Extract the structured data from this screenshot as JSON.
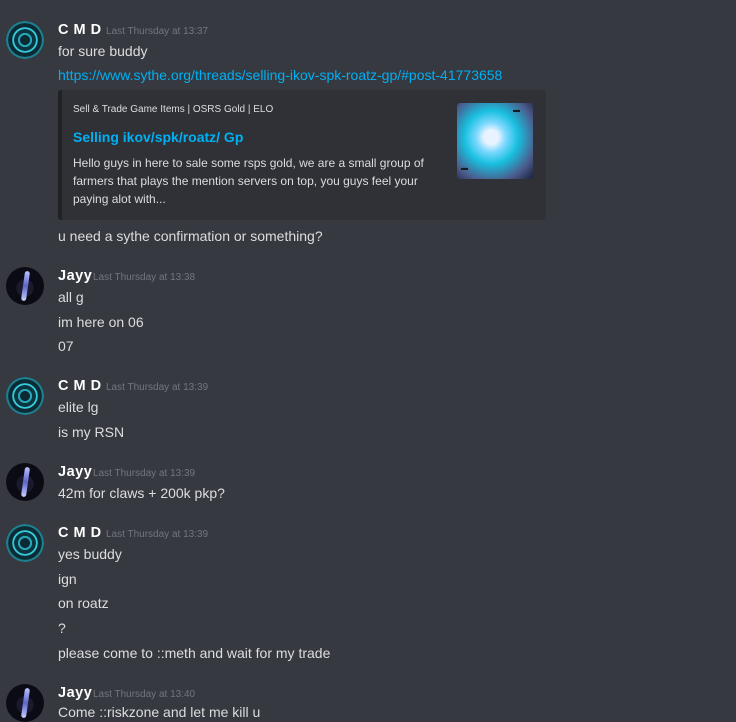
{
  "groups": [
    {
      "user": "C M D",
      "timestamp": "Last Thursday at 13:37",
      "messages": [
        "for sure buddy"
      ],
      "link": "https://www.sythe.org/threads/selling-ikov-spk-roatz-gp/#post-41773658",
      "embed": {
        "provider": "Sell & Trade Game Items | OSRS Gold | ELO",
        "title": "Selling ikov/spk/roatz/ Gp",
        "description": "Hello guys in here to sale some rsps gold, we are a small group of farmers that plays the mention servers on top, you guys feel your paying alot with..."
      },
      "after_embed": "u need a sythe confirmation or something?"
    },
    {
      "user": "Jayy",
      "timestamp": "Last Thursday at 13:38",
      "messages": [
        "all g",
        "im here on 06",
        "07"
      ]
    },
    {
      "user": "C M D",
      "timestamp": "Last Thursday at 13:39",
      "messages": [
        "elite lg",
        "is my RSN"
      ]
    },
    {
      "user": "Jayy",
      "timestamp": "Last Thursday at 13:39",
      "messages": [
        "42m for claws + 200k pkp?"
      ]
    },
    {
      "user": "C M D",
      "timestamp": "Last Thursday at 13:39",
      "messages": [
        "yes  buddy",
        "ign",
        "on roatz",
        "?",
        "please come to  ::meth and wait for my trade"
      ]
    },
    {
      "user": "Jayy",
      "timestamp": "Last Thursday at 13:40",
      "messages": [
        "Come ::riskzone and let me kill u"
      ]
    }
  ],
  "icons": {
    "avatar_cmd": "cmd-avatar-icon",
    "avatar_jayy": "jayy-avatar-icon"
  }
}
